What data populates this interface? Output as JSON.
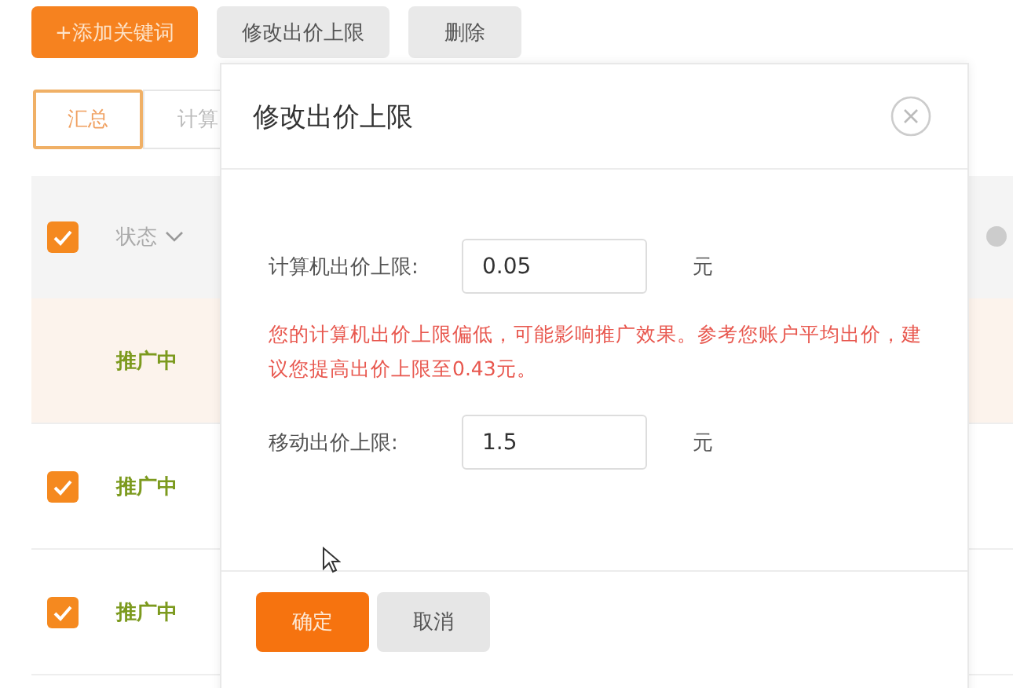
{
  "toolbar": [
    {
      "label": "+添加关键词",
      "kind": "primary"
    },
    {
      "label": "修改出价上限",
      "kind": "secondary"
    },
    {
      "label": "删除",
      "kind": "secondary"
    }
  ],
  "tabs": [
    {
      "label": "汇总",
      "selected": true
    },
    {
      "label": "计算",
      "selected": false
    }
  ],
  "table": {
    "header": {
      "checked": true,
      "status_label": "状态"
    },
    "rows": [
      {
        "status": "推广中",
        "checked": false,
        "highlighted": true
      },
      {
        "status": "推广中",
        "checked": true,
        "highlighted": false
      },
      {
        "status": "推广中",
        "checked": true,
        "highlighted": false
      }
    ]
  },
  "dialog": {
    "title": "修改出价上限",
    "fields": [
      {
        "label": "计算机出价上限:",
        "value": "0.05",
        "unit": "元"
      },
      {
        "label": "移动出价上限:",
        "value": "1.5",
        "unit": "元"
      }
    ],
    "warning": "您的计算机出价上限偏低，可能影响推广效果。参考您账户平均出价，建议您提高出价上限至0.43元。",
    "buttons": [
      {
        "label": "确定",
        "kind": "primary"
      },
      {
        "label": "取消",
        "kind": "secondary"
      }
    ]
  }
}
